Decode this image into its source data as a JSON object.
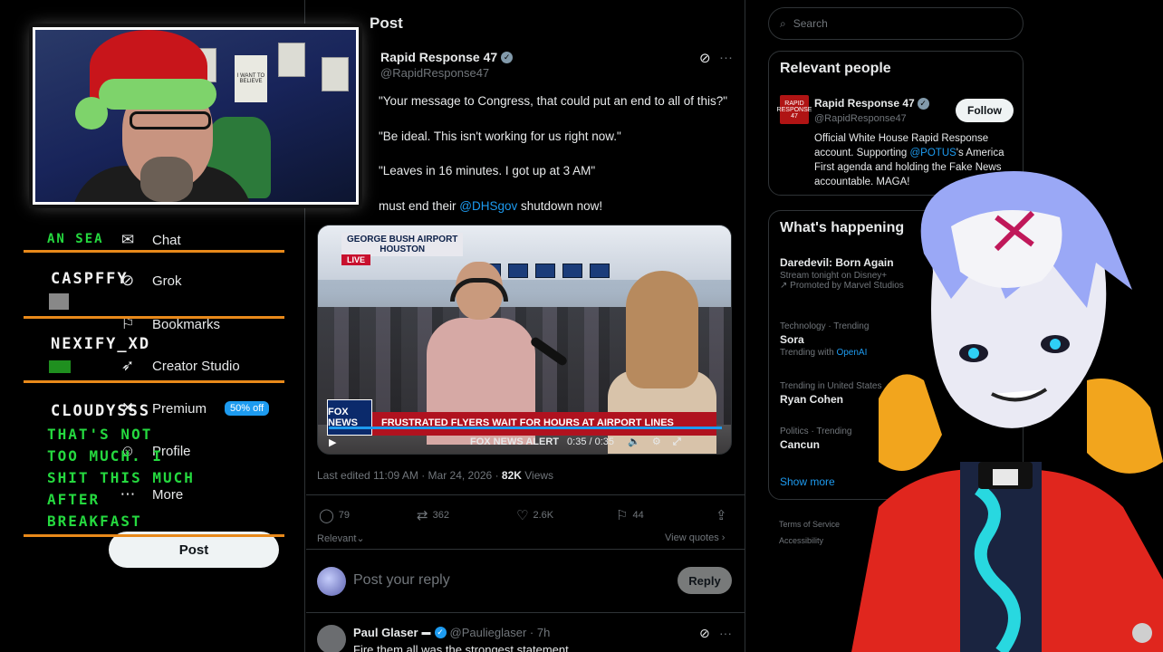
{
  "nav": {
    "chat": "Chat",
    "grok": "Grok",
    "bookmarks": "Bookmarks",
    "creator_studio": "Creator Studio",
    "premium": "Premium",
    "premium_badge": "50% off",
    "profile": "Profile",
    "more": "More",
    "post_button": "Post"
  },
  "main": {
    "title": "Post",
    "author": {
      "name": "Rapid Response 47",
      "handle": "@RapidResponse47"
    },
    "lines": [
      "\"Your message to Congress, that could put an end to all of this?\"",
      "\"Be ideal. This isn't working for us right now.\"",
      "\"Leaves in 16 minutes. I got up at 3 AM\"",
      "must end their "
    ],
    "mention": "@DHSgov",
    "line4_tail": " shutdown now!",
    "video": {
      "location": "GEORGE BUSH AIRPORT\nHOUSTON",
      "live": "LIVE",
      "network": "FOX NEWS",
      "headline": "FRUSTRATED FLYERS WAIT FOR HOURS AT AIRPORT LINES",
      "alert": "FOX NEWS ALERT",
      "time": "0:35 / 0:35",
      "progress": 1.0
    },
    "edited_prefix": "Last edited 11:09 AM · Mar 24, 2026 · ",
    "views_count": "82K",
    "views_label": " Views",
    "actions": {
      "replies": "79",
      "reposts": "362",
      "likes": "2.6K",
      "bookmarks": "44"
    },
    "relevant": "Relevant",
    "view_quotes": "View quotes",
    "reply_placeholder": "Post your reply",
    "reply_button": "Reply",
    "reply2": {
      "name": "Paul Glaser",
      "meta": "@Paulieglaser · 7h",
      "text": "Fire them all was the strongest statement"
    }
  },
  "sidebar": {
    "search_placeholder": "Search",
    "relevant_people": {
      "title": "Relevant people",
      "logo_text": "RAPID RESPONSE 47",
      "name": "Rapid Response 47",
      "handle": "@RapidResponse47",
      "follow": "Follow",
      "bio_pre": "Official White House Rapid Response account. Supporting ",
      "bio_mention": "@POTUS",
      "bio_post": "'s America First agenda and holding the Fake News accountable. MAGA!"
    },
    "whats_happening": {
      "title": "What's happening",
      "trends": [
        {
          "topic": "Daredevil: Born Again",
          "sub": "Stream tonight on Disney+",
          "promo": "Promoted by Marvel Studios"
        },
        {
          "category": "Technology · Trending",
          "topic": "Sora",
          "sub_pre": "Trending with ",
          "sub_link": "OpenAI"
        },
        {
          "category": "Trending in United States",
          "topic": "Ryan Cohen"
        },
        {
          "category": "Politics · Trending",
          "topic": "Cancun"
        }
      ],
      "show_more": "Show more"
    },
    "footer": {
      "terms": "Terms of Service",
      "accessibility": "Accessibility"
    }
  },
  "overlay": {
    "chat_top": "AN SEA",
    "users": [
      {
        "name": "CASPFFY"
      },
      {
        "name": "NEXIFY_XD"
      },
      {
        "name": "CLOUDYSSS"
      }
    ],
    "message": "THAT'S NOT\nTOO MUCH. I\nSHIT THIS MUCH\nAFTER\nBREAKFAST",
    "poster_text": "I WANT TO BELIEVE"
  },
  "colors": {
    "accent": "#1d9bf0",
    "chat_bar": "#e8891a",
    "chat_text": "#25d93f",
    "vtuber_jacket": "#e0261e",
    "vtuber_fur": "#f2a51d",
    "vtuber_hair": "#9aa8f6"
  }
}
